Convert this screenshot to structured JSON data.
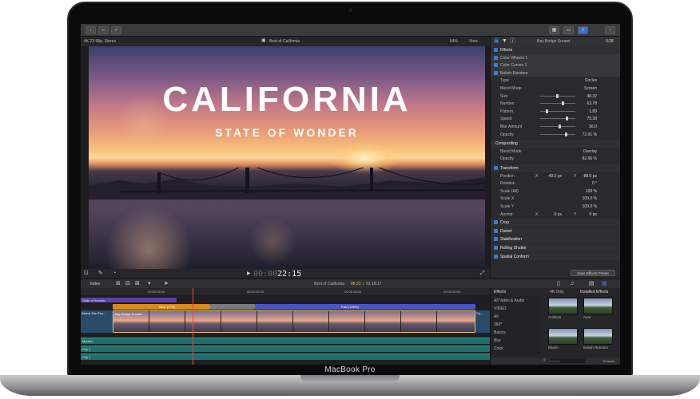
{
  "device": {
    "model": "MacBook Pro"
  },
  "viewer": {
    "format": "4K 23.98p, Stereo",
    "project": "Best of California",
    "zoom": "64%",
    "view_label": "View",
    "title": "CALIFORNIA",
    "subtitle": "STATE OF WONDER",
    "timecode_dim": "00:00",
    "timecode": "22:15"
  },
  "inspector": {
    "clip_name": "Bay Bridge Sunset",
    "duration": "0:28",
    "effects_header": "Effects",
    "effects": [
      "Color Wheels 1",
      "Color Curves 1",
      "Bokeh Random"
    ],
    "bokeh_params": [
      {
        "label": "Type",
        "value": "Circles",
        "slider": null
      },
      {
        "label": "Blend Mode",
        "value": "Screen",
        "slider": null
      },
      {
        "label": "Size",
        "value": "48.32",
        "slider": 0.48
      },
      {
        "label": "Number",
        "value": "63.78",
        "slider": 0.64
      },
      {
        "label": "Pattern",
        "value": "1.89",
        "slider": 0.19
      },
      {
        "label": "Speed",
        "value": "75.38",
        "slider": 0.75
      },
      {
        "label": "Blur Amount",
        "value": "56.0",
        "slider": 0.56
      },
      {
        "label": "Opacity",
        "value": "72.91 %",
        "slider": 0.73
      }
    ],
    "compositing": {
      "header": "Compositing",
      "blend_label": "Blend Mode",
      "blend_value": "Overlay",
      "opacity_label": "Opacity",
      "opacity_value": "82.66 %"
    },
    "transform": {
      "header": "Transform",
      "rows": [
        {
          "label": "Position",
          "x_label": "X",
          "x": "-49.0 px",
          "y_label": "Y",
          "y": "-88.0 px"
        },
        {
          "label": "Rotation",
          "value": "0 °"
        },
        {
          "label": "Scale (All)",
          "value": "109 %"
        },
        {
          "label": "Scale X",
          "value": "109.0 %"
        },
        {
          "label": "Scale Y",
          "value": "109.0 %"
        },
        {
          "label": "Anchor",
          "x_label": "X",
          "x": "0 px",
          "y_label": "Y",
          "y": "0 px"
        }
      ]
    },
    "sections": [
      "Crop",
      "Distort",
      "Stabilization",
      "Rolling Shutter",
      "Spatial Conform"
    ],
    "save_button": "Save Effects Preset"
  },
  "timeline": {
    "index_label": "Index",
    "project": "Best of California",
    "position": "05:23",
    "total": "01:18:17",
    "ruler_marks": [
      "00:00:28:00",
      "00:00:32:00",
      "00:00:36:00",
      "00:00:40:00"
    ],
    "title_track": "State of Wonder",
    "speed_slow": "Slow (47%)",
    "speed_fast": "Fast (128%)",
    "clip_left": "Above San Fra...",
    "clip_main": "Bay Bridge Sunset",
    "clip_right": "Co...",
    "audio_tracks": [
      "Modern",
      "City 1",
      "City 1"
    ]
  },
  "browser": {
    "header": "Effects",
    "filter_4k": "4K Only",
    "installed": "Installed Effects",
    "categories": [
      "All Video & Audio",
      "VIDEO",
      "All",
      "360°",
      "Basics",
      "Blur",
      "Color"
    ],
    "effects": [
      "Artifacts",
      "Aura",
      "Bloom",
      "Bokeh Random"
    ],
    "search_placeholder": "Search",
    "count": "15 items"
  }
}
